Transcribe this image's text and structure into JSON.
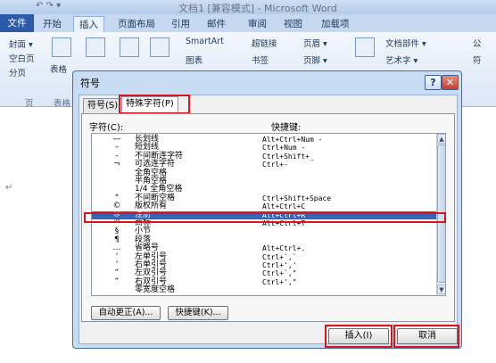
{
  "app": {
    "title": "文档1 [兼容模式] - Microsoft Word",
    "qat": "↶ ↷ ▾"
  },
  "ribbon": {
    "tabs": [
      "文件",
      "开始",
      "插入",
      "页面布局",
      "引用",
      "邮件",
      "审阅",
      "视图",
      "加载项"
    ],
    "active_tab": "插入",
    "items": {
      "cover": "封面 ▾",
      "blank_page": "空白页",
      "page_break": "分页",
      "table": "表格",
      "picture": "图片",
      "clipart": "剪贴画",
      "shapes": "形状",
      "smartart": "SmartArt",
      "chart": "图表",
      "hyperlink": "超链接",
      "bookmark": "书签",
      "header": "页眉 ▾",
      "footer": "页脚 ▾",
      "textbox": "文本框",
      "quickparts": "文档部件 ▾",
      "wordart": "艺术字 ▾",
      "formula": "公",
      "symbol": "符"
    },
    "groups": {
      "pages": "页",
      "tables": "表格"
    }
  },
  "dialog": {
    "title": "符号",
    "help_label": "?",
    "close_label": "✕",
    "tabs": [
      "符号(S)",
      "特殊字符(P)"
    ],
    "active_tab": "特殊字符(P)",
    "col_char": "字符(C):",
    "col_shortcut": "快捷键:",
    "rows": [
      {
        "sym": "—",
        "name": "长划线",
        "key": "Alt+Ctrl+Num -"
      },
      {
        "sym": "–",
        "name": "短划线",
        "key": "Ctrl+Num -"
      },
      {
        "sym": "‑",
        "name": "不间断连字符",
        "key": "Ctrl+Shift+_"
      },
      {
        "sym": "¬",
        "name": "可选连字符",
        "key": "Ctrl+-"
      },
      {
        "sym": "",
        "name": "全角空格",
        "key": ""
      },
      {
        "sym": "",
        "name": "半角空格",
        "key": ""
      },
      {
        "sym": "",
        "name": "1/4 全角空格",
        "key": ""
      },
      {
        "sym": "°",
        "name": "不间断空格",
        "key": "Ctrl+Shift+Space"
      },
      {
        "sym": "©",
        "name": "版权所有",
        "key": "Alt+Ctrl+C"
      },
      {
        "sym": "®",
        "name": "注册",
        "key": "Alt+Ctrl+R"
      },
      {
        "sym": "™",
        "name": "商标",
        "key": "Alt+Ctrl+T"
      },
      {
        "sym": "§",
        "name": "小节",
        "key": ""
      },
      {
        "sym": "¶",
        "name": "段落",
        "key": ""
      },
      {
        "sym": "…",
        "name": "省略号",
        "key": "Alt+Ctrl+."
      },
      {
        "sym": "‘",
        "name": "左单引号",
        "key": "Ctrl+`,`"
      },
      {
        "sym": "’",
        "name": "右单引号",
        "key": "Ctrl+','"
      },
      {
        "sym": "“",
        "name": "左双引号",
        "key": "Ctrl+`,\""
      },
      {
        "sym": "”",
        "name": "右双引号",
        "key": "Ctrl+',\""
      },
      {
        "sym": "",
        "name": "零宽度空格",
        "key": ""
      }
    ],
    "selected_index": 9,
    "autocorrect_button": "自动更正(A)...",
    "shortcut_button": "快捷键(K)...",
    "insert_button": "插入(I)",
    "cancel_button": "取消"
  }
}
